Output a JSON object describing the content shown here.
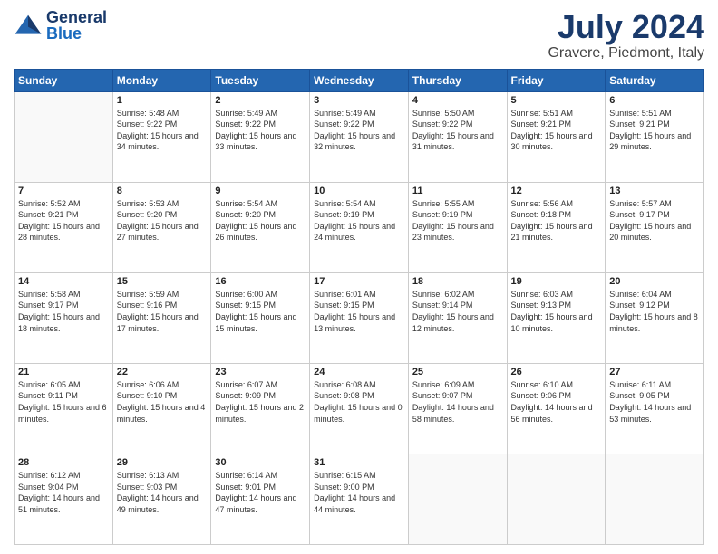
{
  "header": {
    "logo_general": "General",
    "logo_blue": "Blue",
    "month_title": "July 2024",
    "location": "Gravere, Piedmont, Italy"
  },
  "days_of_week": [
    "Sunday",
    "Monday",
    "Tuesday",
    "Wednesday",
    "Thursday",
    "Friday",
    "Saturday"
  ],
  "weeks": [
    [
      {
        "day": "",
        "sunrise": "",
        "sunset": "",
        "daylight": ""
      },
      {
        "day": "1",
        "sunrise": "Sunrise: 5:48 AM",
        "sunset": "Sunset: 9:22 PM",
        "daylight": "Daylight: 15 hours and 34 minutes."
      },
      {
        "day": "2",
        "sunrise": "Sunrise: 5:49 AM",
        "sunset": "Sunset: 9:22 PM",
        "daylight": "Daylight: 15 hours and 33 minutes."
      },
      {
        "day": "3",
        "sunrise": "Sunrise: 5:49 AM",
        "sunset": "Sunset: 9:22 PM",
        "daylight": "Daylight: 15 hours and 32 minutes."
      },
      {
        "day": "4",
        "sunrise": "Sunrise: 5:50 AM",
        "sunset": "Sunset: 9:22 PM",
        "daylight": "Daylight: 15 hours and 31 minutes."
      },
      {
        "day": "5",
        "sunrise": "Sunrise: 5:51 AM",
        "sunset": "Sunset: 9:21 PM",
        "daylight": "Daylight: 15 hours and 30 minutes."
      },
      {
        "day": "6",
        "sunrise": "Sunrise: 5:51 AM",
        "sunset": "Sunset: 9:21 PM",
        "daylight": "Daylight: 15 hours and 29 minutes."
      }
    ],
    [
      {
        "day": "7",
        "sunrise": "Sunrise: 5:52 AM",
        "sunset": "Sunset: 9:21 PM",
        "daylight": "Daylight: 15 hours and 28 minutes."
      },
      {
        "day": "8",
        "sunrise": "Sunrise: 5:53 AM",
        "sunset": "Sunset: 9:20 PM",
        "daylight": "Daylight: 15 hours and 27 minutes."
      },
      {
        "day": "9",
        "sunrise": "Sunrise: 5:54 AM",
        "sunset": "Sunset: 9:20 PM",
        "daylight": "Daylight: 15 hours and 26 minutes."
      },
      {
        "day": "10",
        "sunrise": "Sunrise: 5:54 AM",
        "sunset": "Sunset: 9:19 PM",
        "daylight": "Daylight: 15 hours and 24 minutes."
      },
      {
        "day": "11",
        "sunrise": "Sunrise: 5:55 AM",
        "sunset": "Sunset: 9:19 PM",
        "daylight": "Daylight: 15 hours and 23 minutes."
      },
      {
        "day": "12",
        "sunrise": "Sunrise: 5:56 AM",
        "sunset": "Sunset: 9:18 PM",
        "daylight": "Daylight: 15 hours and 21 minutes."
      },
      {
        "day": "13",
        "sunrise": "Sunrise: 5:57 AM",
        "sunset": "Sunset: 9:17 PM",
        "daylight": "Daylight: 15 hours and 20 minutes."
      }
    ],
    [
      {
        "day": "14",
        "sunrise": "Sunrise: 5:58 AM",
        "sunset": "Sunset: 9:17 PM",
        "daylight": "Daylight: 15 hours and 18 minutes."
      },
      {
        "day": "15",
        "sunrise": "Sunrise: 5:59 AM",
        "sunset": "Sunset: 9:16 PM",
        "daylight": "Daylight: 15 hours and 17 minutes."
      },
      {
        "day": "16",
        "sunrise": "Sunrise: 6:00 AM",
        "sunset": "Sunset: 9:15 PM",
        "daylight": "Daylight: 15 hours and 15 minutes."
      },
      {
        "day": "17",
        "sunrise": "Sunrise: 6:01 AM",
        "sunset": "Sunset: 9:15 PM",
        "daylight": "Daylight: 15 hours and 13 minutes."
      },
      {
        "day": "18",
        "sunrise": "Sunrise: 6:02 AM",
        "sunset": "Sunset: 9:14 PM",
        "daylight": "Daylight: 15 hours and 12 minutes."
      },
      {
        "day": "19",
        "sunrise": "Sunrise: 6:03 AM",
        "sunset": "Sunset: 9:13 PM",
        "daylight": "Daylight: 15 hours and 10 minutes."
      },
      {
        "day": "20",
        "sunrise": "Sunrise: 6:04 AM",
        "sunset": "Sunset: 9:12 PM",
        "daylight": "Daylight: 15 hours and 8 minutes."
      }
    ],
    [
      {
        "day": "21",
        "sunrise": "Sunrise: 6:05 AM",
        "sunset": "Sunset: 9:11 PM",
        "daylight": "Daylight: 15 hours and 6 minutes."
      },
      {
        "day": "22",
        "sunrise": "Sunrise: 6:06 AM",
        "sunset": "Sunset: 9:10 PM",
        "daylight": "Daylight: 15 hours and 4 minutes."
      },
      {
        "day": "23",
        "sunrise": "Sunrise: 6:07 AM",
        "sunset": "Sunset: 9:09 PM",
        "daylight": "Daylight: 15 hours and 2 minutes."
      },
      {
        "day": "24",
        "sunrise": "Sunrise: 6:08 AM",
        "sunset": "Sunset: 9:08 PM",
        "daylight": "Daylight: 15 hours and 0 minutes."
      },
      {
        "day": "25",
        "sunrise": "Sunrise: 6:09 AM",
        "sunset": "Sunset: 9:07 PM",
        "daylight": "Daylight: 14 hours and 58 minutes."
      },
      {
        "day": "26",
        "sunrise": "Sunrise: 6:10 AM",
        "sunset": "Sunset: 9:06 PM",
        "daylight": "Daylight: 14 hours and 56 minutes."
      },
      {
        "day": "27",
        "sunrise": "Sunrise: 6:11 AM",
        "sunset": "Sunset: 9:05 PM",
        "daylight": "Daylight: 14 hours and 53 minutes."
      }
    ],
    [
      {
        "day": "28",
        "sunrise": "Sunrise: 6:12 AM",
        "sunset": "Sunset: 9:04 PM",
        "daylight": "Daylight: 14 hours and 51 minutes."
      },
      {
        "day": "29",
        "sunrise": "Sunrise: 6:13 AM",
        "sunset": "Sunset: 9:03 PM",
        "daylight": "Daylight: 14 hours and 49 minutes."
      },
      {
        "day": "30",
        "sunrise": "Sunrise: 6:14 AM",
        "sunset": "Sunset: 9:01 PM",
        "daylight": "Daylight: 14 hours and 47 minutes."
      },
      {
        "day": "31",
        "sunrise": "Sunrise: 6:15 AM",
        "sunset": "Sunset: 9:00 PM",
        "daylight": "Daylight: 14 hours and 44 minutes."
      },
      {
        "day": "",
        "sunrise": "",
        "sunset": "",
        "daylight": ""
      },
      {
        "day": "",
        "sunrise": "",
        "sunset": "",
        "daylight": ""
      },
      {
        "day": "",
        "sunrise": "",
        "sunset": "",
        "daylight": ""
      }
    ]
  ]
}
